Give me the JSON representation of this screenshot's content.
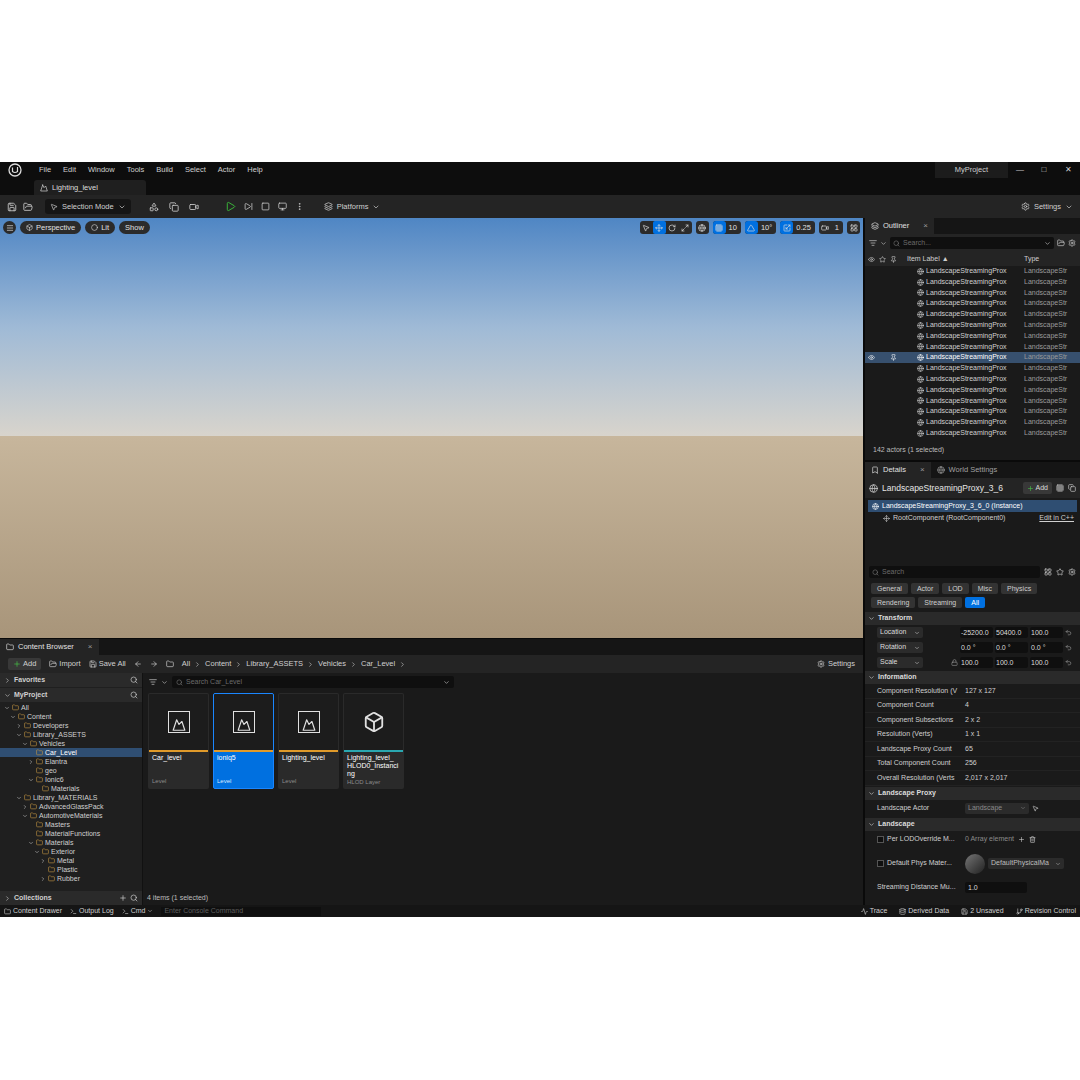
{
  "menu_bar": {
    "items": [
      "File",
      "Edit",
      "Window",
      "Tools",
      "Build",
      "Select",
      "Actor",
      "Help"
    ],
    "project": "MyProject",
    "window_controls": [
      "—",
      "□",
      "✕"
    ]
  },
  "level_tab": {
    "label": "Lighting_level"
  },
  "toolbar": {
    "mode": "Selection Mode",
    "platforms": "Platforms",
    "settings": "Settings"
  },
  "viewport": {
    "buttons": [
      "Perspective",
      "Lit",
      "Show"
    ],
    "transform_tools": [
      {
        "selected": false
      },
      {
        "selected": true
      },
      {
        "selected": false
      },
      {
        "selected": false
      }
    ],
    "snaps": [
      {
        "value": "10",
        "on": true
      },
      {
        "value": "10°",
        "on": true
      },
      {
        "value": "0.25",
        "on": true
      },
      {
        "value": "1",
        "on": false
      }
    ]
  },
  "outliner": {
    "title": "Outliner",
    "close": "×",
    "search_placeholder": "Search...",
    "columns": [
      "Item Label ▲",
      "Type"
    ],
    "rows": [
      {
        "label": "LandscapeStreamingProx",
        "type": "LandscapeStr",
        "selected": false
      },
      {
        "label": "LandscapeStreamingProx",
        "type": "LandscapeStr",
        "selected": false
      },
      {
        "label": "LandscapeStreamingProx",
        "type": "LandscapeStr",
        "selected": false
      },
      {
        "label": "LandscapeStreamingProx",
        "type": "LandscapeStr",
        "selected": false
      },
      {
        "label": "LandscapeStreamingProx",
        "type": "LandscapeStr",
        "selected": false
      },
      {
        "label": "LandscapeStreamingProx",
        "type": "LandscapeStr",
        "selected": false
      },
      {
        "label": "LandscapeStreamingProx",
        "type": "LandscapeStr",
        "selected": false
      },
      {
        "label": "LandscapeStreamingProx",
        "type": "LandscapeStr",
        "selected": false
      },
      {
        "label": "LandscapeStreamingProx",
        "type": "LandscapeStr",
        "selected": true
      },
      {
        "label": "LandscapeStreamingProx",
        "type": "LandscapeStr",
        "selected": false
      },
      {
        "label": "LandscapeStreamingProx",
        "type": "LandscapeStr",
        "selected": false
      },
      {
        "label": "LandscapeStreamingProx",
        "type": "LandscapeStr",
        "selected": false
      },
      {
        "label": "LandscapeStreamingProx",
        "type": "LandscapeStr",
        "selected": false
      },
      {
        "label": "LandscapeStreamingProx",
        "type": "LandscapeStr",
        "selected": false
      },
      {
        "label": "LandscapeStreamingProx",
        "type": "LandscapeStr",
        "selected": false
      },
      {
        "label": "LandscapeStreamingProx",
        "type": "LandscapeStr",
        "selected": false
      }
    ],
    "footer": "142 actors (1 selected)"
  },
  "details": {
    "tabs": [
      {
        "label": "Details",
        "close": "×",
        "selected": true
      },
      {
        "label": "World Settings",
        "close": "",
        "selected": false
      }
    ],
    "actor": "LandscapeStreamingProxy_3_6",
    "add": "Add",
    "components": [
      {
        "label": "LandscapeStreamingProxy_3_6_0 (Instance)",
        "selected": true,
        "action": ""
      },
      {
        "label": "RootComponent (RootComponent0)",
        "selected": false,
        "action": "Edit in C++"
      }
    ],
    "search_placeholder": "Search",
    "filters": [
      {
        "label": "General",
        "selected": false
      },
      {
        "label": "Actor",
        "selected": false
      },
      {
        "label": "LOD",
        "selected": false
      },
      {
        "label": "Misc",
        "selected": false
      },
      {
        "label": "Physics",
        "selected": false
      },
      {
        "label": "Rendering",
        "selected": false
      },
      {
        "label": "Streaming",
        "selected": false
      },
      {
        "label": "All",
        "selected": true
      }
    ],
    "transform": {
      "title": "Transform",
      "expanded": true,
      "rows": [
        {
          "label": "Location",
          "values": [
            "-25200.0",
            "50400.0",
            "100.0"
          ]
        },
        {
          "label": "Rotation",
          "values": [
            "0.0 °",
            "0.0 °",
            "0.0 °"
          ]
        },
        {
          "label": "Scale",
          "values": [
            "100.0",
            "100.0",
            "100.0"
          ]
        }
      ]
    },
    "information": {
      "title": "Information",
      "expanded": true,
      "rows": [
        {
          "label": "Component Resolution (V",
          "value": "127 x 127"
        },
        {
          "label": "Component Count",
          "value": "4"
        },
        {
          "label": "Component Subsections",
          "value": "2 x 2"
        },
        {
          "label": "Resolution (Verts)",
          "value": "1 x 1"
        },
        {
          "label": "Landscape Proxy Count",
          "value": "65"
        },
        {
          "label": "Total Component Count",
          "value": "256"
        },
        {
          "label": "Overall Resolution (Verts",
          "value": "2,017 x 2,017"
        }
      ]
    },
    "landscape_proxy": {
      "title": "Landscape Proxy",
      "expanded": true,
      "rows": [
        {
          "label": "Landscape Actor",
          "value": "Landscape"
        }
      ]
    },
    "landscape": {
      "title": "Landscape",
      "expanded": true,
      "rows": [
        {
          "kind": "array",
          "label": "Per LODOverride M...",
          "checked": false,
          "value": "0 Array element"
        },
        {
          "kind": "asset",
          "label": "Default Phys Mater...",
          "checked": false,
          "value": "DefaultPhysicalMa"
        },
        {
          "kind": "number",
          "label": "Streaming Distance Mu...",
          "value": "1.0"
        }
      ]
    }
  },
  "content_browser": {
    "title": "Content Browser",
    "close": "×",
    "add": "Add",
    "import": "Import",
    "save_all": "Save All",
    "breadcrumbs": [
      "All",
      "Content",
      "Library_ASSETS",
      "Vehicles",
      "Car_Level"
    ],
    "settings": "Settings",
    "favorites": "Favorites",
    "project": "MyProject",
    "tree": [
      {
        "label": "All",
        "depth": 0,
        "expandable": true,
        "expanded": true,
        "selected": false
      },
      {
        "label": "Content",
        "depth": 1,
        "expandable": true,
        "expanded": true,
        "selected": false
      },
      {
        "label": "Developers",
        "depth": 2,
        "expandable": true,
        "expanded": false,
        "selected": false
      },
      {
        "label": "Library_ASSETS",
        "depth": 2,
        "expandable": true,
        "expanded": true,
        "selected": false
      },
      {
        "label": "Vehicles",
        "depth": 3,
        "expandable": true,
        "expanded": true,
        "selected": false
      },
      {
        "label": "Car_Level",
        "depth": 4,
        "expandable": false,
        "expanded": false,
        "selected": true
      },
      {
        "label": "Elantra",
        "depth": 4,
        "expandable": true,
        "expanded": false,
        "selected": false
      },
      {
        "label": "geo",
        "depth": 4,
        "expandable": false,
        "expanded": false,
        "selected": false
      },
      {
        "label": "Ionic6",
        "depth": 4,
        "expandable": true,
        "expanded": true,
        "selected": false
      },
      {
        "label": "Materials",
        "depth": 5,
        "expandable": false,
        "expanded": false,
        "selected": false
      },
      {
        "label": "Library_MATERIALS",
        "depth": 2,
        "expandable": true,
        "expanded": true,
        "selected": false
      },
      {
        "label": "AdvancedGlassPack",
        "depth": 3,
        "expandable": true,
        "expanded": false,
        "selected": false
      },
      {
        "label": "AutomotiveMaterials",
        "depth": 3,
        "expandable": true,
        "expanded": true,
        "selected": false
      },
      {
        "label": "Masters",
        "depth": 4,
        "expandable": false,
        "expanded": false,
        "selected": false
      },
      {
        "label": "MaterialFunctions",
        "depth": 4,
        "expandable": false,
        "expanded": false,
        "selected": false
      },
      {
        "label": "Materials",
        "depth": 4,
        "expandable": true,
        "expanded": true,
        "selected": false
      },
      {
        "label": "Exterior",
        "depth": 5,
        "expandable": true,
        "expanded": true,
        "selected": false
      },
      {
        "label": "Metal",
        "depth": 6,
        "expandable": true,
        "expanded": false,
        "selected": false
      },
      {
        "label": "Plastic",
        "depth": 6,
        "expandable": false,
        "expanded": false,
        "selected": false
      },
      {
        "label": "Rubber",
        "depth": 6,
        "expandable": true,
        "expanded": false,
        "selected": false
      }
    ],
    "collections": "Collections",
    "search_placeholder": "Search Car_Level",
    "assets": [
      {
        "name": "Car_level",
        "type": "Level",
        "kind": "level",
        "color": "#e09a2a",
        "selected": false
      },
      {
        "name": "ioniq5",
        "type": "Level",
        "kind": "level",
        "color": "#e09a2a",
        "selected": true
      },
      {
        "name": "Lighting_level",
        "type": "Level",
        "kind": "level",
        "color": "#e09a2a",
        "selected": false
      },
      {
        "name": "Lighting_level_ HLOD0_Instancing",
        "type": "HLOD Layer",
        "kind": "hlod",
        "color": "#2aa7b0",
        "selected": false
      }
    ],
    "footer": "4 items (1 selected)"
  },
  "status_bar": {
    "items": [
      "Content Drawer",
      "Output Log",
      "Cmd"
    ],
    "console_placeholder": "Enter Console Command",
    "right": [
      "Trace",
      "Derived Data",
      "2 Unsaved",
      "Revision Control"
    ]
  }
}
